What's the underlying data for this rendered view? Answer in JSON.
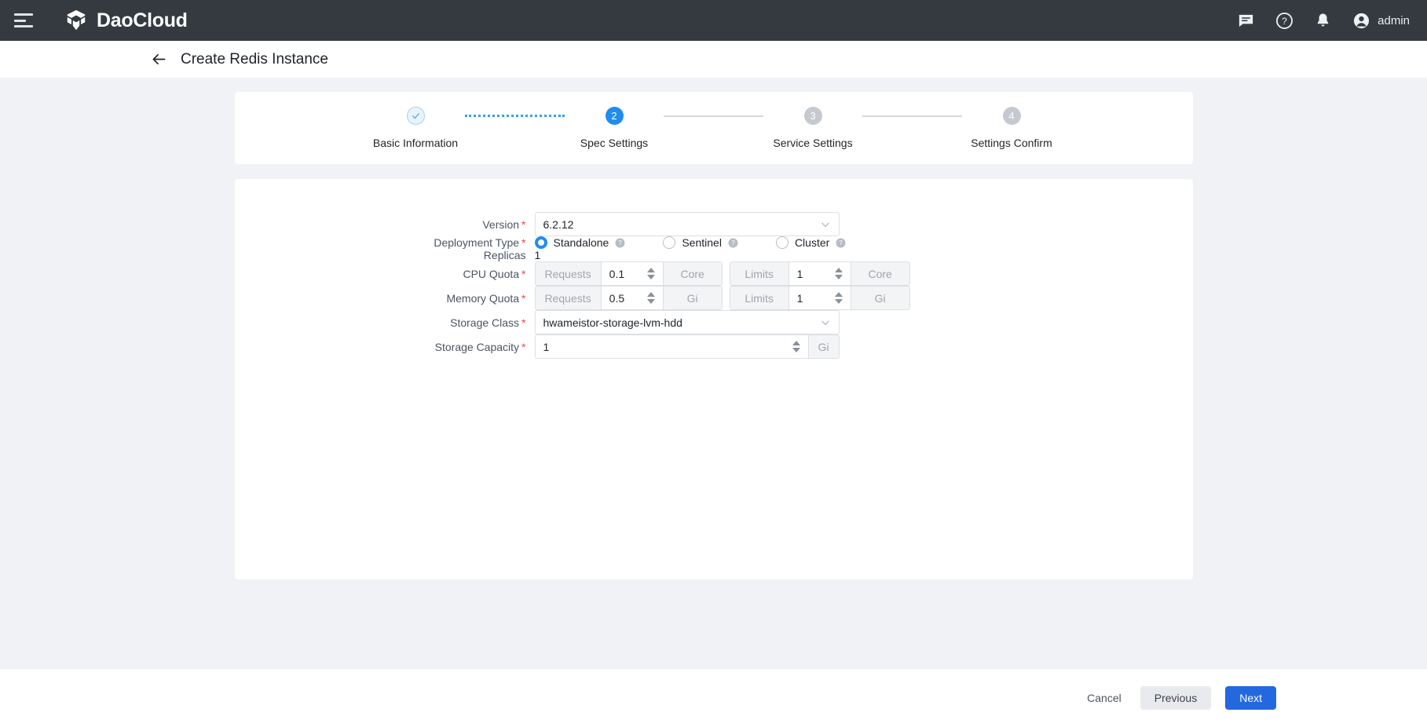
{
  "topbar": {
    "menu_icon": "hamburger-icon",
    "brand": "DaoCloud",
    "icons": [
      "chat-icon",
      "help-icon",
      "bell-icon"
    ],
    "user": "admin"
  },
  "page": {
    "back_icon": "back-arrow-icon",
    "title": "Create Redis Instance"
  },
  "stepper": {
    "steps": [
      {
        "num": "✓",
        "label": "Basic Information",
        "state": "done"
      },
      {
        "num": "2",
        "label": "Spec Settings",
        "state": "active"
      },
      {
        "num": "3",
        "label": "Service Settings",
        "state": "todo"
      },
      {
        "num": "4",
        "label": "Settings Confirm",
        "state": "todo"
      }
    ]
  },
  "form": {
    "version": {
      "label": "Version",
      "value": "6.2.12",
      "required": true
    },
    "deployment_type": {
      "label": "Deployment Type",
      "required": true,
      "options": [
        {
          "label": "Standalone",
          "selected": true
        },
        {
          "label": "Sentinel",
          "selected": false
        },
        {
          "label": "Cluster",
          "selected": false
        }
      ]
    },
    "replicas": {
      "label": "Replicas",
      "value": "1",
      "required": false
    },
    "cpu_quota": {
      "label": "CPU Quota",
      "required": true,
      "requests_addon": "Requests",
      "requests_value": "0.1",
      "requests_unit": "Core",
      "limits_addon": "Limits",
      "limits_value": "1",
      "limits_unit": "Core"
    },
    "memory_quota": {
      "label": "Memory Quota",
      "required": true,
      "requests_addon": "Requests",
      "requests_value": "0.5",
      "requests_unit": "Gi",
      "limits_addon": "Limits",
      "limits_value": "1",
      "limits_unit": "Gi"
    },
    "storage_class": {
      "label": "Storage Class",
      "value": "hwameistor-storage-lvm-hdd",
      "required": true
    },
    "storage_capacity": {
      "label": "Storage Capacity",
      "value": "1",
      "unit": "Gi",
      "required": true
    }
  },
  "footer": {
    "cancel": "Cancel",
    "previous": "Previous",
    "next": "Next"
  },
  "colors": {
    "topbar_bg": "#343a40",
    "page_bg": "#f1f2f6",
    "accent_blue": "#1f8ded",
    "primary_button": "#2468e0",
    "required_red": "#e5484d",
    "step_todo": "#c5cad1"
  }
}
